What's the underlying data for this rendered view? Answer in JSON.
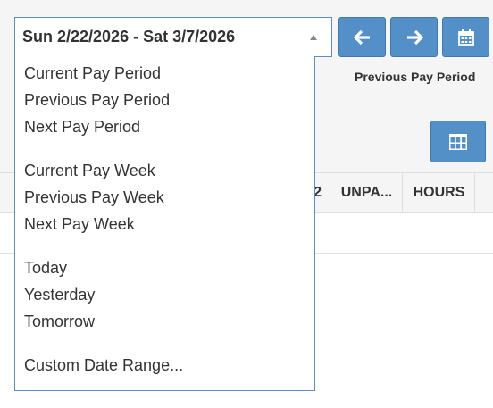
{
  "date_range": {
    "value": "Sun 2/22/2026 - Sat 3/7/2026"
  },
  "nav": {
    "period_label": "Previous Pay Period"
  },
  "table": {
    "headers": [
      "2",
      "UNPA...",
      "HOURS"
    ]
  },
  "dropdown": {
    "groups": [
      [
        "Current Pay Period",
        "Previous Pay Period",
        "Next Pay Period"
      ],
      [
        "Current Pay Week",
        "Previous Pay Week",
        "Next Pay Week"
      ],
      [
        "Today",
        "Yesterday",
        "Tomorrow"
      ],
      [
        "Custom Date Range..."
      ]
    ]
  },
  "icons": {
    "prev": "arrow-left-icon",
    "next": "arrow-right-icon",
    "calendar": "calendar-icon",
    "columns": "grid-columns-icon"
  },
  "colors": {
    "accent": "#5390c8",
    "accent_border": "#3f78ad",
    "select_border": "#5b8fc2",
    "panel_bg": "#f5f5f5"
  }
}
